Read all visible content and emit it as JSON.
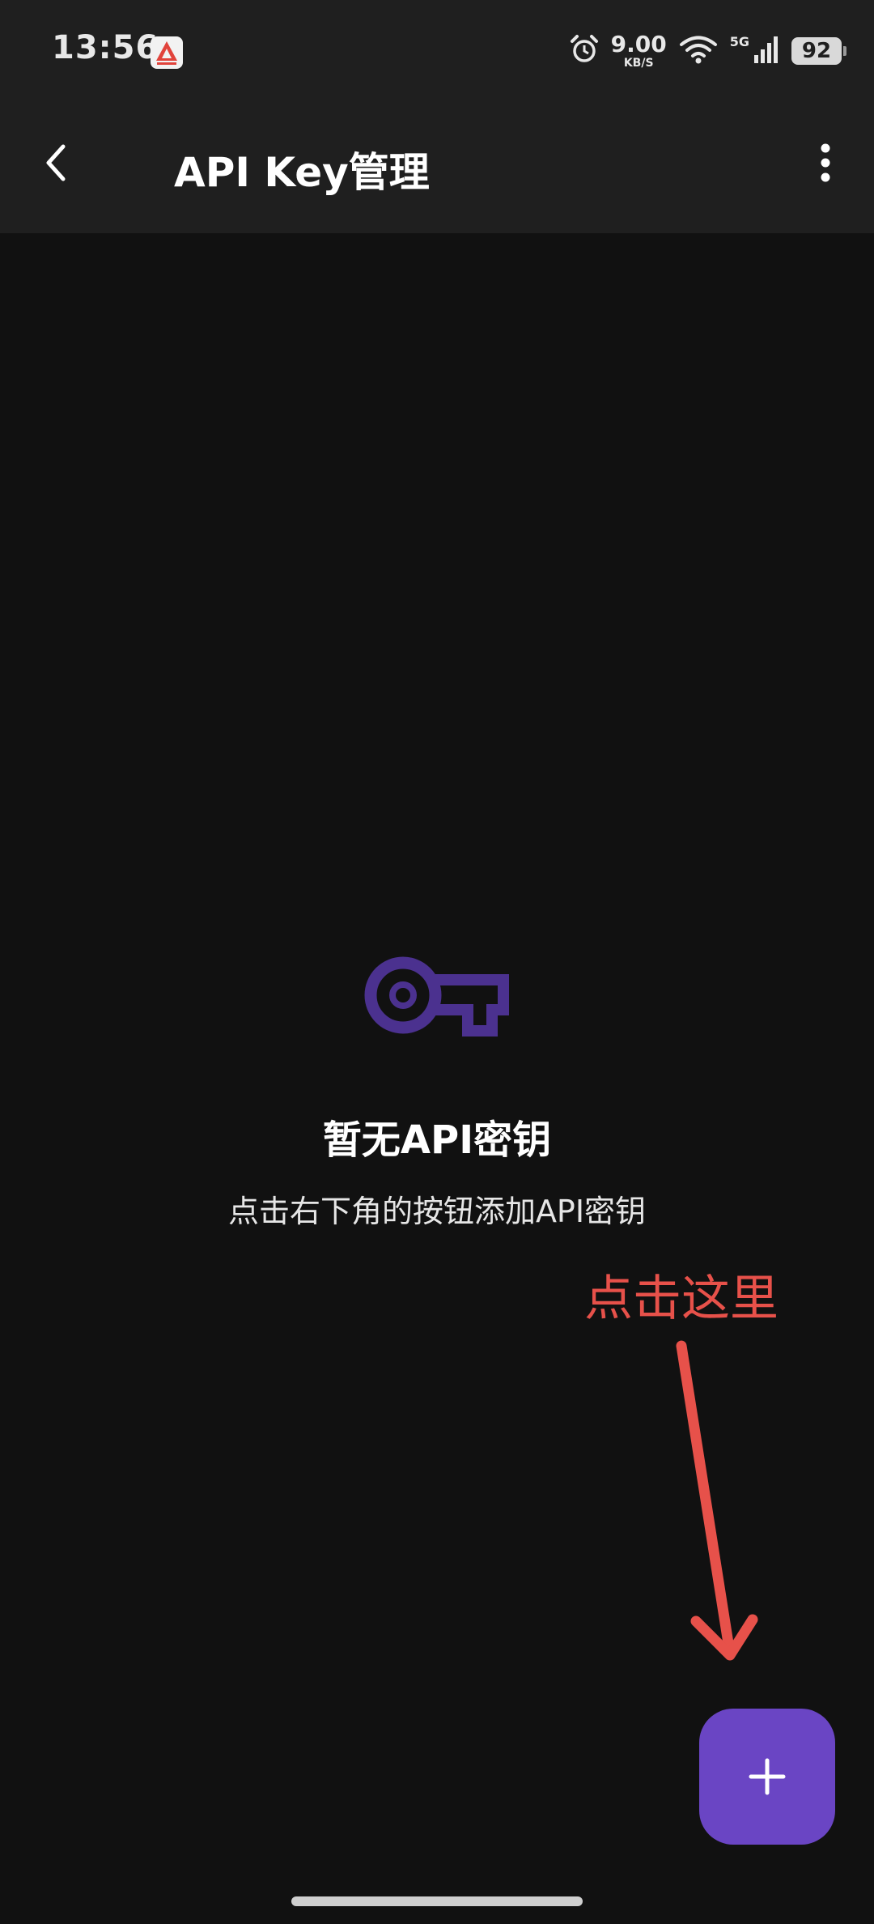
{
  "status_bar": {
    "time": "13:56",
    "net_speed_value": "9.00",
    "net_speed_unit": "KB/S",
    "network_type": "5G",
    "battery": "92",
    "icons": [
      "app-notification-icon",
      "alarm-icon",
      "wifi-icon",
      "signal-icon",
      "battery-icon"
    ]
  },
  "app_bar": {
    "title": "API Key管理",
    "back_icon": "chevron-left-icon",
    "menu_icon": "more-vert-icon"
  },
  "empty_state": {
    "icon": "key-icon",
    "title": "暂无API密钥",
    "subtitle": "点击右下角的按钮添加API密钥"
  },
  "annotation": {
    "text": "点击这里",
    "icon": "arrow-down-icon"
  },
  "fab": {
    "icon": "plus-icon"
  },
  "colors": {
    "background": "#111111",
    "bar_background": "#1f1f1f",
    "accent": "#6a45c4",
    "key_icon": "#4b318f",
    "annotation": "#e7514a"
  }
}
